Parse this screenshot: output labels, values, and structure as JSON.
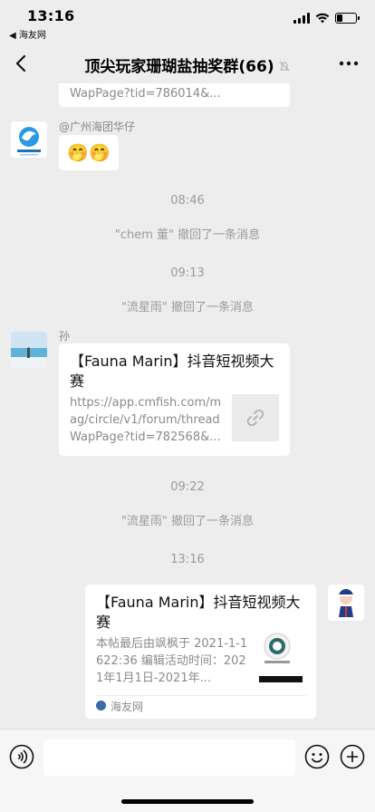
{
  "status": {
    "time": "13:16",
    "back_app": "◀ 海友网",
    "battery_level": 0.3
  },
  "nav": {
    "title": "顶尖玩家珊瑚盐抽奖群(66)",
    "icons": {
      "back": "chevron-left-icon",
      "mute": "mute-bell-icon",
      "more": "more-dots-icon"
    }
  },
  "chat": {
    "top_partial_link": "WapPage?tid=786014&...",
    "msg1": {
      "sender": "@广州海团华仔",
      "content": "🤭🤭"
    },
    "ts1": "08:46",
    "recall1": "\"chem 董\" 撤回了一条消息",
    "ts2": "09:13",
    "recall2": "\"流星雨\" 撤回了一条消息",
    "msg2": {
      "sender": "孙",
      "title": "【Fauna Marin】抖音短视频大赛",
      "url": "https://app.cmfish.com/mag/circle/v1/forum/threadWapPage?tid=782568&..."
    },
    "ts3": "09:22",
    "recall3": "\"流星雨\" 撤回了一条消息",
    "ts4": "13:16",
    "msg3": {
      "title": "【Fauna Marin】抖音短视频大赛",
      "desc": "本帖最后由飒枫于 2021-1-1622:36 编辑活动时间：2021年1月1日-2021年...",
      "source": "海友网"
    }
  },
  "colors": {
    "background": "#ededed",
    "bubble": "#ffffff",
    "system_text": "#9b9b9b"
  }
}
